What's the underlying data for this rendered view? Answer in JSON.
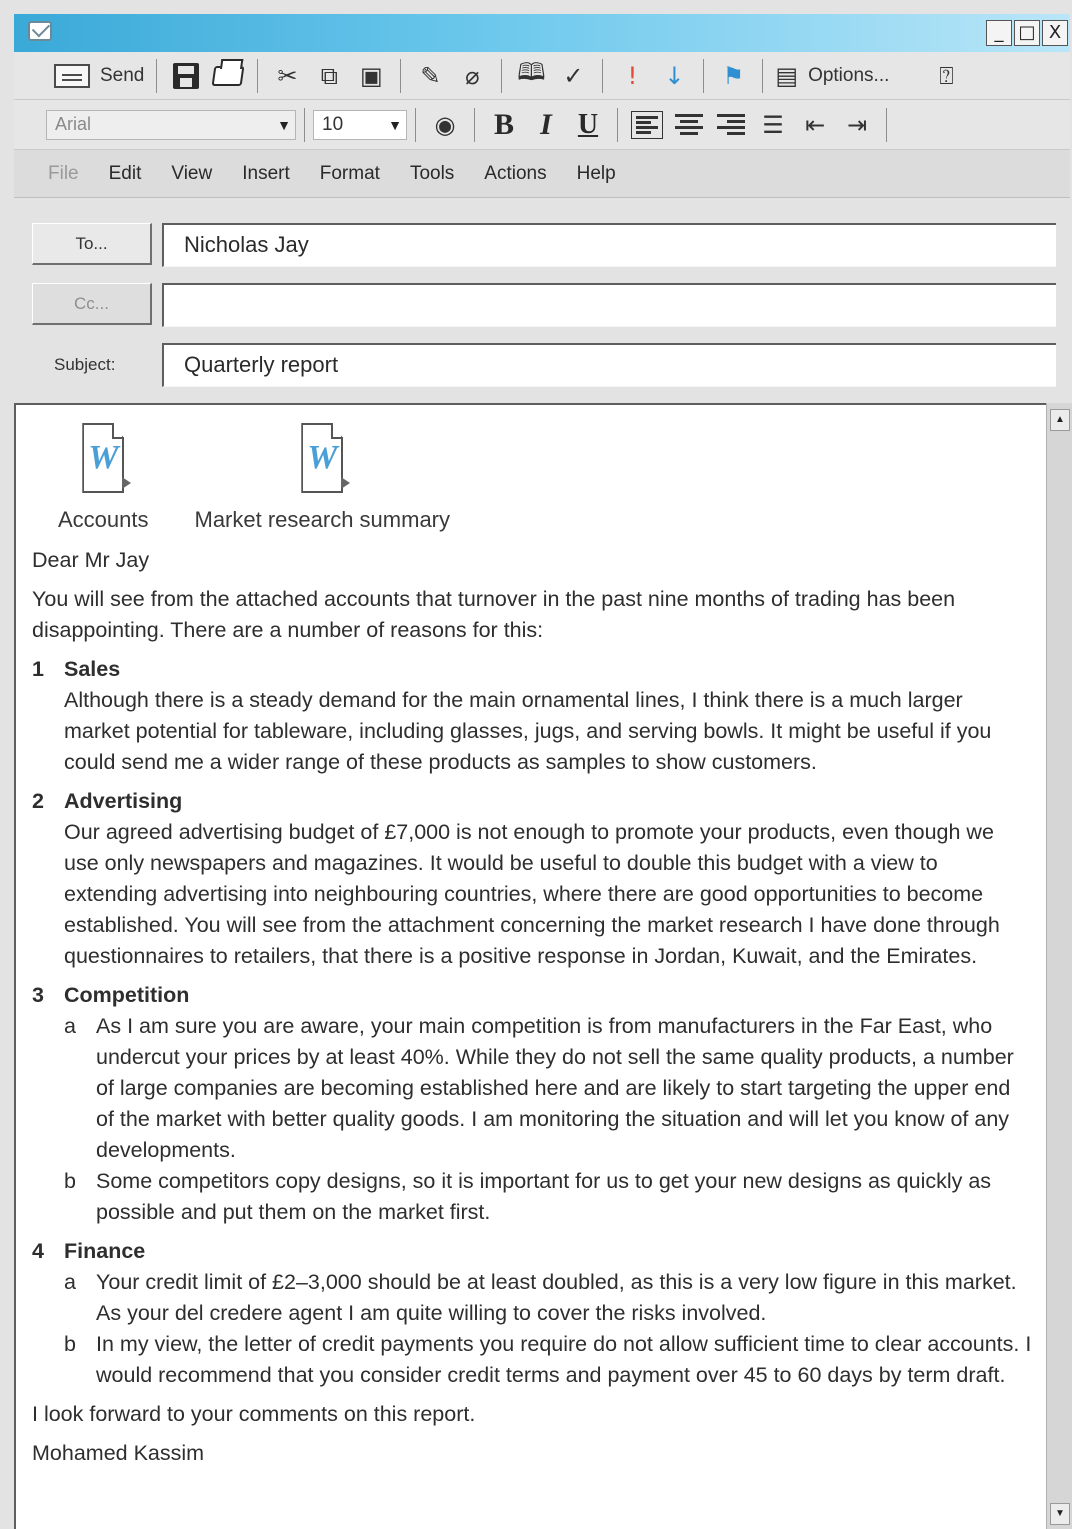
{
  "window": {
    "controls": [
      "_",
      "□",
      "X"
    ]
  },
  "toolbar": {
    "send_label": "Send",
    "options_label": "Options..."
  },
  "format_bar": {
    "font": "Arial",
    "size": "10",
    "bold": "B",
    "italic": "I",
    "underline": "U"
  },
  "menu": {
    "items": [
      "File",
      "Edit",
      "View",
      "Insert",
      "Format",
      "Tools",
      "Actions",
      "Help"
    ]
  },
  "header": {
    "to_button": "To...",
    "cc_button": "Cc...",
    "subject_label": "Subject:",
    "to_value": "Nicholas Jay",
    "cc_value": "",
    "subject_value": "Quarterly report"
  },
  "attachments": [
    {
      "name": "Accounts",
      "icon": "word-document-icon"
    },
    {
      "name": "Market research summary",
      "icon": "word-document-icon"
    }
  ],
  "letter": {
    "salutation": "Dear Mr Jay",
    "intro": "You will see from the attached accounts that turnover in the past nine months of trading has been disappointing. There are a number of reasons for this:",
    "s1_num": "1",
    "s1_title": "Sales",
    "s1_body": "Although there is a steady demand for the main ornamental lines, I think there is a much larger market potential for tableware, including glasses, jugs, and serving bowls. It might be useful if you could send me a wider range of these products as samples to show customers.",
    "s2_num": "2",
    "s2_title": "Advertising",
    "s2_body": "Our agreed advertising budget of £7,000 is not enough to promote your products, even though we use only newspapers and magazines. It would be useful to double this budget with a view to extending advertising into neighbouring countries, where there are good opportunities to become established. You will see from the attachment concerning the market research I have done through questionnaires to retailers, that there is a positive response in Jordan, Kuwait, and the Emirates.",
    "s3_num": "3",
    "s3_title": "Competition",
    "s3_a_letter": "a",
    "s3_a": "As I am sure you are aware, your main competition is from manufacturers in the Far East, who undercut your prices by at least 40%. While they do not sell the same quality products, a number of large companies are becoming established here and are likely to start targeting the upper end of the market with better quality goods. I am monitoring the situation and will let you know of any developments.",
    "s3_b_letter": "b",
    "s3_b": "Some competitors copy designs, so it is important for us to get your new designs as quickly as possible and put them on the market first.",
    "s4_num": "4",
    "s4_title": "Finance",
    "s4_a_letter": "a",
    "s4_a": "Your credit limit of £2–3,000 should be at least doubled, as this is a very low figure in this market. As your del credere agent I am quite willing to cover the risks involved.",
    "s4_b_letter": "b",
    "s4_b": "In my view, the letter of credit payments you require do not allow sufficient time to clear accounts. I would recommend that you consider credit terms and payment over 45 to 60 days by term draft.",
    "closing": "I look forward to your comments on this report.",
    "signature": "Mohamed Kassim"
  },
  "colors": {
    "titlebar_start": "#3aa9d8",
    "titlebar_end": "#b9e6f8",
    "accent_blue": "#2f8fd0",
    "word_icon_blue": "#4a9fd6"
  }
}
